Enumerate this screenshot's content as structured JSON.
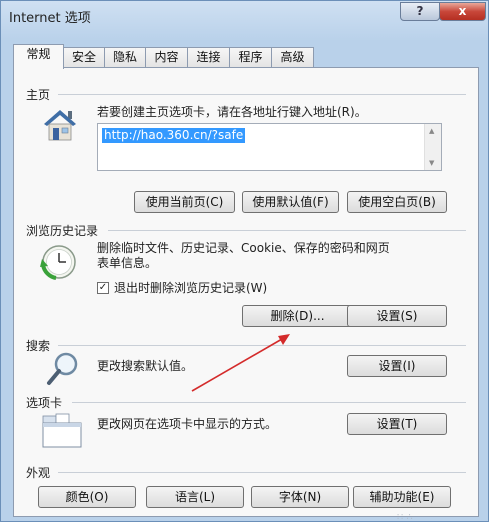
{
  "window": {
    "title": "Internet 选项",
    "help_label": "?",
    "close_label": "x"
  },
  "tabs": [
    "常规",
    "安全",
    "隐私",
    "内容",
    "连接",
    "程序",
    "高级"
  ],
  "homepage": {
    "title": "主页",
    "description": "若要创建主页选项卡，请在各地址行键入地址(R)。",
    "url": "http://hao.360.cn/?safe",
    "buttons": {
      "use_current": "使用当前页(C)",
      "use_default": "使用默认值(F)",
      "use_blank": "使用空白页(B)"
    }
  },
  "history": {
    "title": "浏览历史记录",
    "description_line1": "删除临时文件、历史记录、Cookie、保存的密码和网页",
    "description_line2": "表单信息。",
    "checkbox_label": "退出时删除浏览历史记录(W)",
    "checkbox_mark": "✓",
    "delete_button": "删除(D)...",
    "settings_button": "设置(S)"
  },
  "search": {
    "title": "搜索",
    "description": "更改搜索默认值。",
    "settings_button": "设置(I)"
  },
  "tabs_section": {
    "title": "选项卡",
    "description": "更改网页在选项卡中显示的方式。",
    "settings_button": "设置(T)"
  },
  "appearance": {
    "title": "外观",
    "buttons": {
      "colors": "颜色(O)",
      "languages": "语言(L)",
      "fonts": "字体(N)",
      "accessibility": "辅助功能(E)"
    }
  },
  "colors": {
    "window_frame": "#b9d1ea",
    "panel": "#f8f8f8",
    "selection": "#3399ff",
    "arrow": "#d42b2b",
    "close_button": "#c8473a"
  }
}
